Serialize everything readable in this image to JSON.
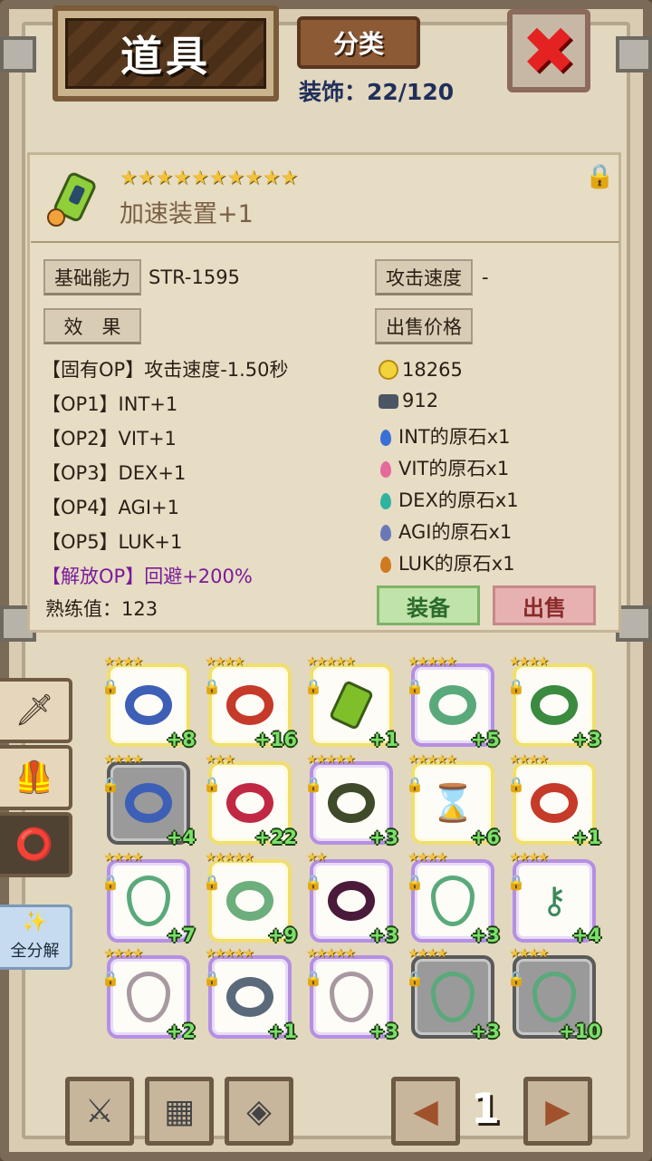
{
  "header": {
    "title": "道具",
    "classify_label": "分类",
    "deco_count": "装饰：22/120",
    "close_label": "✖"
  },
  "detail": {
    "stars": "★★★★★★★★★★",
    "name": "加速装置+1",
    "base_label": "基础能力",
    "base_value": "STR-1595",
    "atk_speed_label": "攻击速度",
    "atk_speed_value": "-",
    "effect_label": "效　果",
    "sell_price_label": "出售价格",
    "effects": [
      "【固有OP】攻击速度-1.50秒",
      "【OP1】INT+1",
      "【OP2】VIT+1",
      "【OP3】DEX+1",
      "【OP4】AGI+1",
      "【OP5】LUK+1"
    ],
    "release_op": "【解放OP】回避+200%",
    "proficiency": "熟练值：123",
    "gold": "18265",
    "ore": "912",
    "stones": [
      {
        "text": "INT的原石x1",
        "color": "#3a6fd6"
      },
      {
        "text": "VIT的原石x1",
        "color": "#e46a9c"
      },
      {
        "text": "DEX的原石x1",
        "color": "#2fb3a0"
      },
      {
        "text": "AGI的原石x1",
        "color": "#6b78b8"
      },
      {
        "text": "LUK的原石x1",
        "color": "#d07a20"
      }
    ],
    "equip_label": "装备",
    "sell_label": "出售"
  },
  "inventory": [
    {
      "stars": "★★★★",
      "level": "+8",
      "frame": "yellow",
      "kind": "ring",
      "color": "#3d5fb5"
    },
    {
      "stars": "★★★★",
      "level": "+16",
      "frame": "yellow",
      "kind": "ring",
      "color": "#c53a28"
    },
    {
      "stars": "★★★★★",
      "level": "+1",
      "frame": "yellow",
      "kind": "device",
      "color": "#7fbf2a"
    },
    {
      "stars": "★★★★★",
      "level": "+5",
      "frame": "purple",
      "kind": "ring",
      "color": "#5aa97a"
    },
    {
      "stars": "★★★★",
      "level": "+3",
      "frame": "yellow",
      "kind": "ring",
      "color": "#3a8a40"
    },
    {
      "stars": "★★★★",
      "level": "+4",
      "frame": "gray",
      "kind": "ring",
      "color": "#3d5fb5"
    },
    {
      "stars": "★★★",
      "level": "+22",
      "frame": "yellow",
      "kind": "ring",
      "color": "#c02844"
    },
    {
      "stars": "★★★★★",
      "level": "+3",
      "frame": "purple",
      "kind": "ring",
      "color": "#3f4a2a"
    },
    {
      "stars": "★★★★★",
      "level": "+6",
      "frame": "yellow",
      "kind": "hourglass",
      "color": "#c8a060"
    },
    {
      "stars": "★★★★",
      "level": "+1",
      "frame": "yellow",
      "kind": "ring",
      "color": "#c53a28"
    },
    {
      "stars": "★★★★",
      "level": "+7",
      "frame": "purple",
      "kind": "neck",
      "color": "#5aa97a"
    },
    {
      "stars": "★★★★★",
      "level": "+9",
      "frame": "yellow",
      "kind": "ring",
      "color": "#6cae7c"
    },
    {
      "stars": "★★",
      "level": "+3",
      "frame": "purple",
      "kind": "ring",
      "color": "#4a1a3a"
    },
    {
      "stars": "★★★★",
      "level": "+3",
      "frame": "purple",
      "kind": "neck",
      "color": "#5aa97a"
    },
    {
      "stars": "★★★★",
      "level": "+4",
      "frame": "purple",
      "kind": "key",
      "color": "#3a8a5a"
    },
    {
      "stars": "★★★★",
      "level": "+2",
      "frame": "purple",
      "kind": "neck",
      "color": "#a898a0"
    },
    {
      "stars": "★★★★★",
      "level": "+1",
      "frame": "purple",
      "kind": "ring",
      "color": "#5a6a7a"
    },
    {
      "stars": "★★★★★",
      "level": "+3",
      "frame": "purple",
      "kind": "neck",
      "color": "#a898a0"
    },
    {
      "stars": "★★★★",
      "level": "+3",
      "frame": "gray",
      "kind": "neck",
      "color": "#5aa97a"
    },
    {
      "stars": "★★★★",
      "level": "+10",
      "frame": "gray",
      "kind": "neck",
      "color": "#5aa97a"
    }
  ],
  "side": {
    "decompose_label": "全分解"
  },
  "pager": {
    "page": "1"
  }
}
